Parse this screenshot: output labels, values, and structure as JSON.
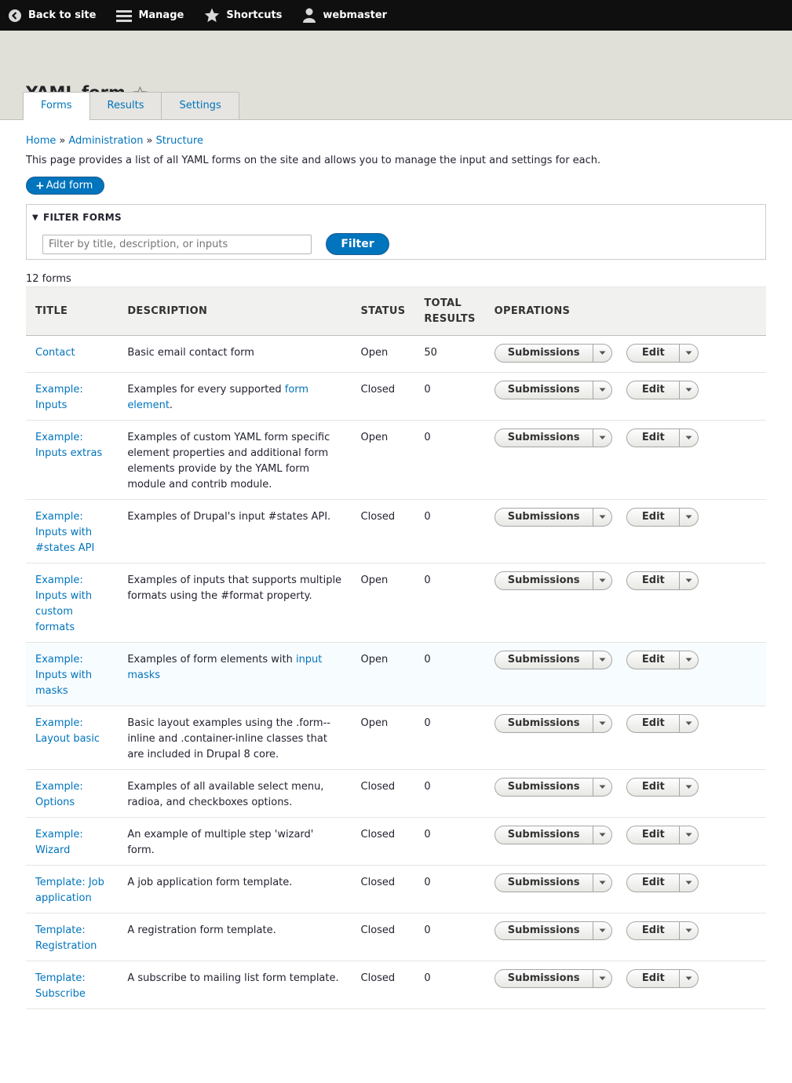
{
  "toolbar": {
    "back": "Back to site",
    "manage": "Manage",
    "shortcuts": "Shortcuts",
    "user": "webmaster"
  },
  "page": {
    "title": "YAML form"
  },
  "tabs": [
    "Forms",
    "Results",
    "Settings"
  ],
  "breadcrumb": [
    "Home",
    "Administration",
    "Structure"
  ],
  "help_text": "This page provides a list of all YAML forms on the site and allows you to manage the input and settings for each.",
  "add_button": "Add form",
  "filter": {
    "legend": "FILTER FORMS",
    "placeholder": "Filter by title, description, or inputs",
    "button": "Filter"
  },
  "count": "12 forms",
  "table": {
    "headers": [
      "TITLE",
      "DESCRIPTION",
      "STATUS",
      "TOTAL RESULTS",
      "OPERATIONS"
    ],
    "submissions_label": "Submissions",
    "edit_label": "Edit",
    "rows": [
      {
        "title": "Contact",
        "desc": "Basic email contact form",
        "status": "Open",
        "results": "50"
      },
      {
        "title": "Example: Inputs",
        "desc": "Examples for every supported ",
        "desc_link": "form element",
        "desc_after": ".",
        "status": "Closed",
        "results": "0"
      },
      {
        "title": "Example: Inputs extras",
        "desc": "Examples of custom YAML form specific element properties and additional form elements provide by the YAML form module and contrib module.",
        "status": "Open",
        "results": "0"
      },
      {
        "title": "Example: Inputs with #states API",
        "desc": "Examples of Drupal's input #states API.",
        "status": "Closed",
        "results": "0"
      },
      {
        "title": "Example: Inputs with custom formats",
        "desc": "Examples of inputs that supports multiple formats using the #format property.",
        "status": "Open",
        "results": "0"
      },
      {
        "title": "Example: Inputs with masks",
        "desc": "Examples of form elements with ",
        "desc_link": "input masks",
        "desc_after": "",
        "status": "Open",
        "results": "0"
      },
      {
        "title": "Example: Layout basic",
        "desc": "Basic layout examples using the .form--inline and .container-inline classes that are included in Drupal 8 core.",
        "status": "Open",
        "results": "0"
      },
      {
        "title": "Example: Options",
        "desc": "Examples of all available select menu, radioa, and checkboxes options.",
        "status": "Closed",
        "results": "0"
      },
      {
        "title": "Example: Wizard",
        "desc": "An example of multiple step 'wizard' form.",
        "status": "Closed",
        "results": "0"
      },
      {
        "title": "Template: Job application",
        "desc": "A job application form template.",
        "status": "Closed",
        "results": "0"
      },
      {
        "title": "Template: Registration",
        "desc": "A registration form template.",
        "status": "Closed",
        "results": "0"
      },
      {
        "title": "Template: Subscribe",
        "desc": "A subscribe to mailing list form template.",
        "status": "Closed",
        "results": "0"
      }
    ]
  }
}
